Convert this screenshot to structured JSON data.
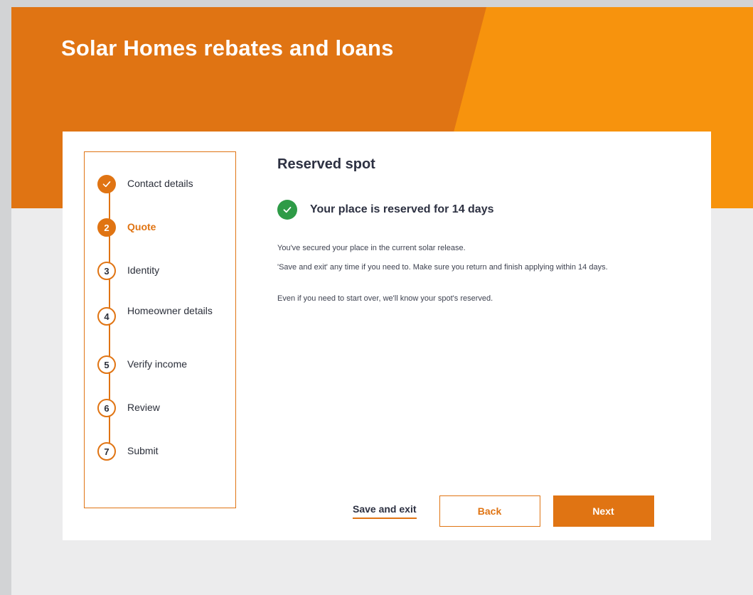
{
  "header": {
    "title": "Solar Homes rebates and loans",
    "colors": {
      "primary_orange": "#e07413",
      "light_orange": "#f7930d"
    }
  },
  "stepper": {
    "steps": [
      {
        "number": "",
        "label": "Contact details",
        "state": "complete",
        "icon": "check-icon"
      },
      {
        "number": "2",
        "label": "Quote",
        "state": "active"
      },
      {
        "number": "3",
        "label": "Identity",
        "state": "upcoming"
      },
      {
        "number": "4",
        "label": "Homeowner details",
        "state": "upcoming"
      },
      {
        "number": "5",
        "label": "Verify income",
        "state": "upcoming"
      },
      {
        "number": "6",
        "label": "Review",
        "state": "upcoming"
      },
      {
        "number": "7",
        "label": "Submit",
        "state": "upcoming"
      }
    ]
  },
  "main": {
    "heading": "Reserved spot",
    "alert": {
      "text": "Your place is reserved for 14 days",
      "icon": "check-circle-icon",
      "color": "#2e9b47"
    },
    "paragraphs": [
      "You've secured your place in the current solar release.",
      "'Save and exit' any time if you need to. Make sure you return and finish applying within 14 days.",
      "Even if you need to start over, we'll know your spot's reserved."
    ]
  },
  "actions": {
    "save_exit": "Save and exit",
    "back": "Back",
    "next": "Next"
  }
}
